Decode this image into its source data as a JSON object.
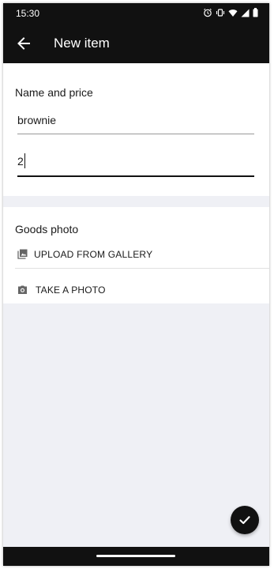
{
  "status_bar": {
    "time": "15:30",
    "icons": [
      "alarm-icon",
      "vibrate-icon",
      "wifi-icon",
      "signal-icon",
      "battery-icon"
    ]
  },
  "app_bar": {
    "title": "New item",
    "back_icon": "arrow-back-icon"
  },
  "name_and_price": {
    "section_title": "Name and price",
    "name_value": "brownie",
    "price_value": "2"
  },
  "goods_photo": {
    "section_title": "Goods photo",
    "upload_label": "UPLOAD FROM GALLERY",
    "upload_icon": "gallery-icon",
    "take_photo_label": "TAKE A PHOTO",
    "take_photo_icon": "camera-icon"
  },
  "fab": {
    "icon": "check-icon"
  },
  "colors": {
    "bar": "#111111",
    "background": "#eff0f5",
    "surface": "#ffffff"
  }
}
